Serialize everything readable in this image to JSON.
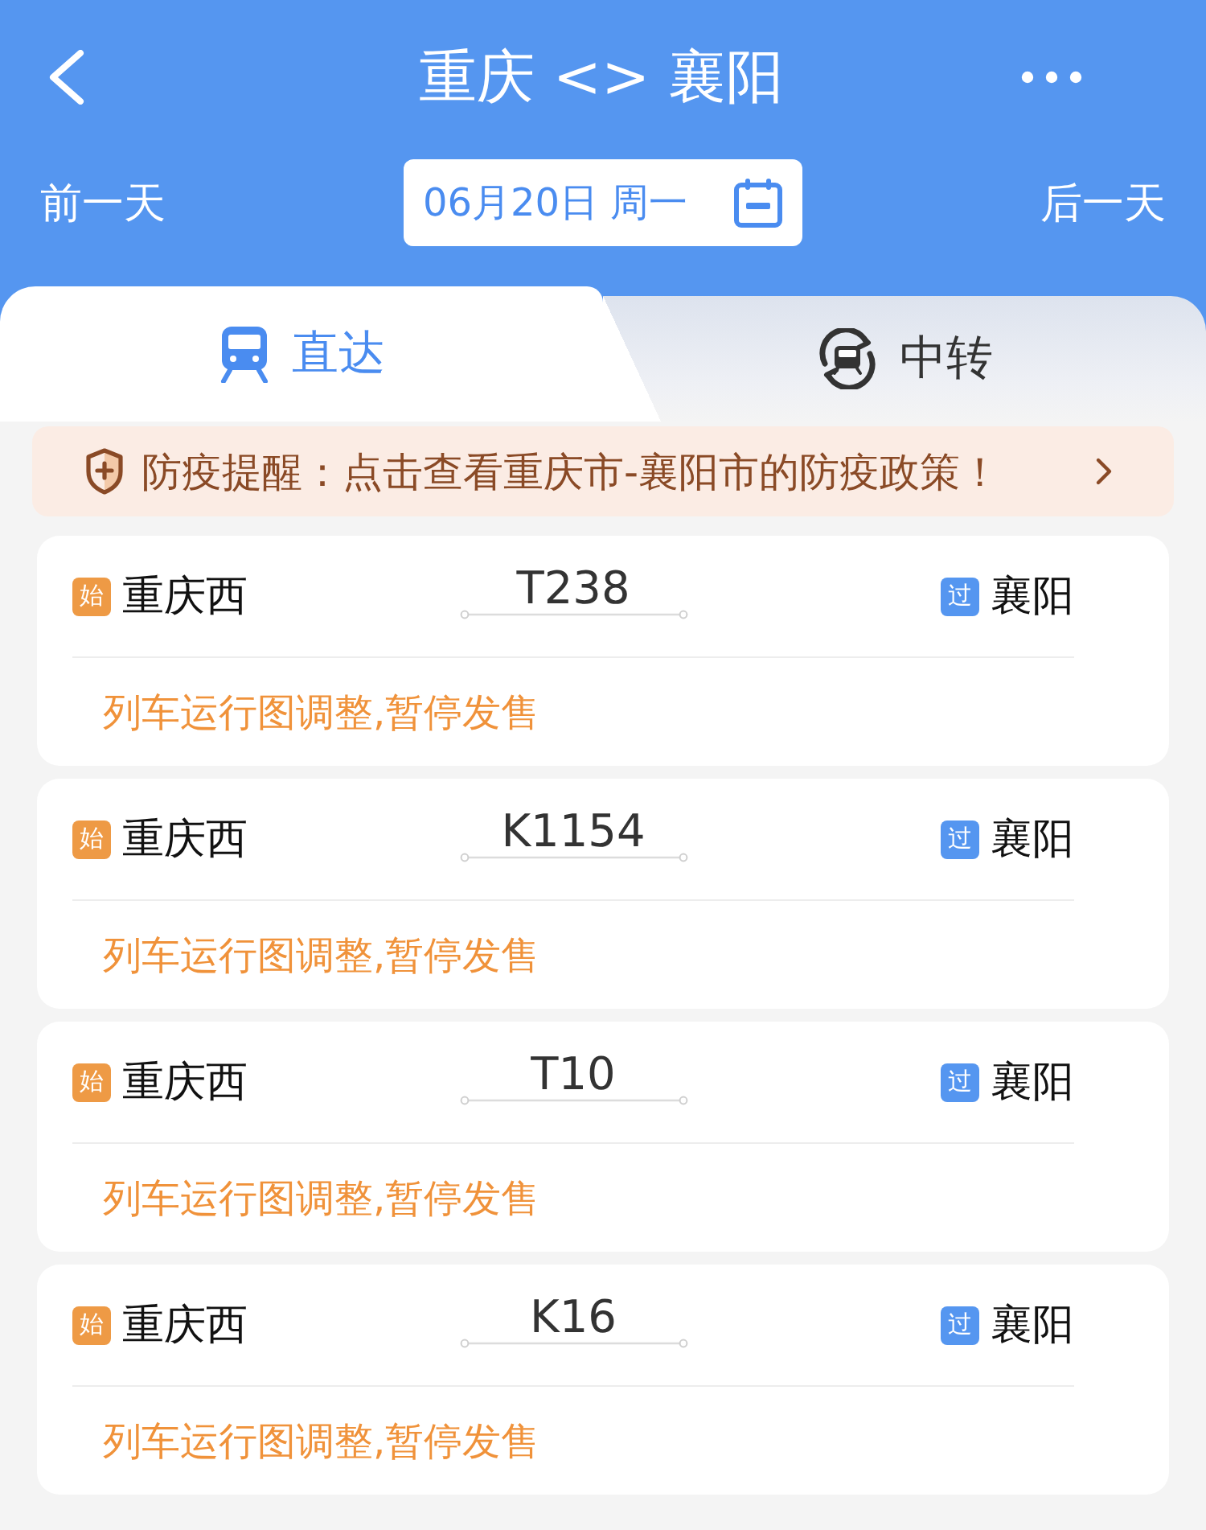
{
  "nav": {
    "title": "重庆 <> 襄阳"
  },
  "date_bar": {
    "prev": "前一天",
    "date": "06月20日 周一",
    "next": "后一天"
  },
  "tabs": [
    {
      "label": "直达",
      "kind": "direct",
      "selected": true
    },
    {
      "label": "中转",
      "kind": "transfer",
      "selected": false
    }
  ],
  "notice": {
    "text": "防疫提醒：点击查看重庆市-襄阳市的防疫政策！"
  },
  "trains": [
    {
      "origin": {
        "tag": "始",
        "kind": "start",
        "station": "重庆西"
      },
      "number": "T238",
      "destination": {
        "tag": "过",
        "kind": "pass",
        "station": "襄阳"
      },
      "status": "列车运行图调整,暂停发售"
    },
    {
      "origin": {
        "tag": "始",
        "kind": "start",
        "station": "重庆西"
      },
      "number": "K1154",
      "destination": {
        "tag": "过",
        "kind": "pass",
        "station": "襄阳"
      },
      "status": "列车运行图调整,暂停发售"
    },
    {
      "origin": {
        "tag": "始",
        "kind": "start",
        "station": "重庆西"
      },
      "number": "T10",
      "destination": {
        "tag": "过",
        "kind": "pass",
        "station": "襄阳"
      },
      "status": "列车运行图调整,暂停发售"
    },
    {
      "origin": {
        "tag": "始",
        "kind": "start",
        "station": "重庆西"
      },
      "number": "K16",
      "destination": {
        "tag": "过",
        "kind": "pass",
        "station": "襄阳"
      },
      "status": "列车运行图调整,暂停发售"
    }
  ]
}
